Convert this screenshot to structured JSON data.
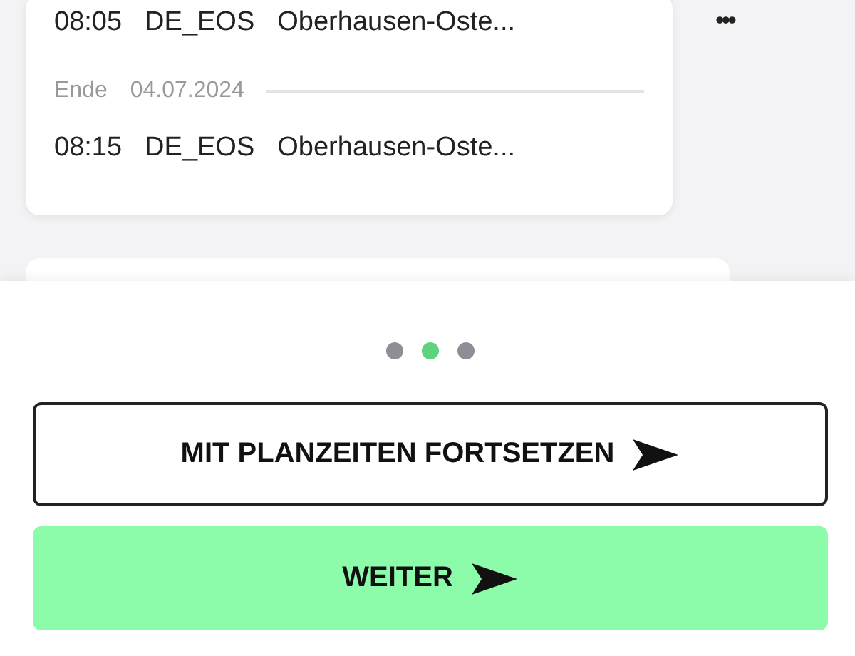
{
  "card": {
    "start_row": {
      "time": "08:05",
      "code": "DE_EOS",
      "place": "Oberhausen-Oste..."
    },
    "end_label": {
      "label": "Ende",
      "date": "04.07.2024"
    },
    "end_row": {
      "time": "08:15",
      "code": "DE_EOS",
      "place": "Oberhausen-Oste..."
    }
  },
  "more_menu": "•••",
  "pager": [
    {
      "selected": false
    },
    {
      "selected": true
    },
    {
      "selected": false
    }
  ],
  "buttons": [
    {
      "kind": "outline",
      "label": "MIT PLANZEITEN FORTSETZEN"
    },
    {
      "kind": "primary",
      "label": "WEITER"
    }
  ]
}
